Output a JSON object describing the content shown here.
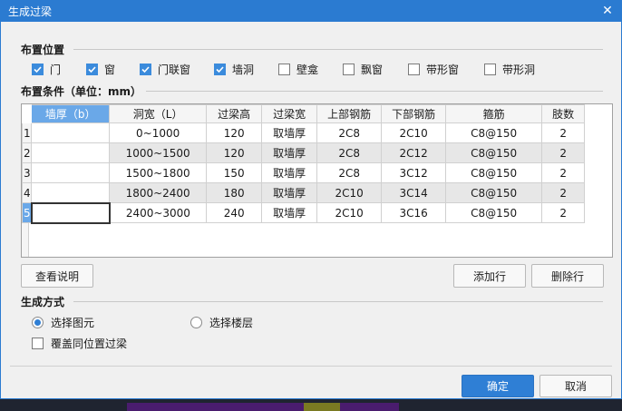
{
  "window": {
    "title": "生成过梁"
  },
  "placement": {
    "title": "布置位置",
    "options": [
      {
        "label": "门",
        "checked": true
      },
      {
        "label": "窗",
        "checked": true
      },
      {
        "label": "门联窗",
        "checked": true
      },
      {
        "label": "墙洞",
        "checked": true
      },
      {
        "label": "壁龛",
        "checked": false
      },
      {
        "label": "飘窗",
        "checked": false
      },
      {
        "label": "带形窗",
        "checked": false
      },
      {
        "label": "带形洞",
        "checked": false
      }
    ]
  },
  "conditions": {
    "title": "布置条件（单位：mm）",
    "columns": [
      "墙厚（b）",
      "洞宽（L）",
      "过梁高",
      "过梁宽",
      "上部钢筋",
      "下部钢筋",
      "箍筋",
      "肢数"
    ],
    "rows": [
      {
        "n": "1",
        "cells": [
          "",
          "0~1000",
          "120",
          "取墙厚",
          "2C8",
          "2C10",
          "C8@150",
          "2"
        ]
      },
      {
        "n": "2",
        "cells": [
          "",
          "1000~1500",
          "120",
          "取墙厚",
          "2C8",
          "2C12",
          "C8@150",
          "2"
        ]
      },
      {
        "n": "3",
        "cells": [
          "",
          "1500~1800",
          "150",
          "取墙厚",
          "2C8",
          "3C12",
          "C8@150",
          "2"
        ]
      },
      {
        "n": "4",
        "cells": [
          "",
          "1800~2400",
          "180",
          "取墙厚",
          "2C10",
          "3C14",
          "C8@150",
          "2"
        ]
      },
      {
        "n": "5",
        "cells": [
          "",
          "2400~3000",
          "240",
          "取墙厚",
          "2C10",
          "3C16",
          "C8@150",
          "2"
        ]
      }
    ]
  },
  "buttons": {
    "view_help": "查看说明",
    "add_row": "添加行",
    "delete_row": "删除行",
    "ok": "确定",
    "cancel": "取消"
  },
  "generation": {
    "title": "生成方式",
    "radio_select_element": "选择图元",
    "radio_select_floor": "选择楼层",
    "overwrite_label": "覆盖同位置过梁",
    "selected": "选择图元",
    "overwrite_checked": false
  },
  "colors": {
    "accent": "#2b7bd1",
    "checkbox": "#3b8bdc",
    "selected_header": "#6aa8e8"
  }
}
